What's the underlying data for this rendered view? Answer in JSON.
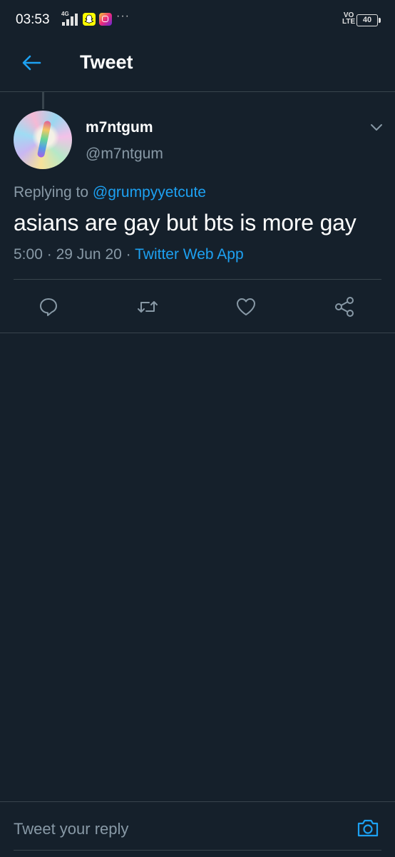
{
  "status_bar": {
    "time": "03:53",
    "network_label": "4G",
    "volte_line1": "VO",
    "volte_line2": "LTE",
    "battery": "40",
    "more": "···",
    "icons": [
      "signal-icon",
      "snapchat-icon",
      "instagram-icon",
      "more-icon",
      "volte-icon",
      "battery-icon"
    ]
  },
  "header": {
    "back_icon": "arrow-left-icon",
    "title": "Tweet"
  },
  "tweet": {
    "display_name": "m7ntgum",
    "handle": "@m7ntgum",
    "replying_prefix": "Replying to",
    "replying_to": "@grumpyyetcute",
    "text": "asians are gay but bts is more gay",
    "time": "5:00",
    "separator": "·",
    "date": "29 Jun 20",
    "source": "Twitter Web App",
    "menu_icon": "chevron-down-icon"
  },
  "actions": [
    {
      "name": "reply",
      "icon": "reply-icon"
    },
    {
      "name": "retweet",
      "icon": "retweet-icon"
    },
    {
      "name": "like",
      "icon": "heart-icon"
    },
    {
      "name": "share",
      "icon": "share-icon"
    }
  ],
  "composer": {
    "placeholder": "Tweet your reply",
    "camera_icon": "camera-icon"
  },
  "colors": {
    "background": "#15202b",
    "accent": "#1da1f2",
    "secondary_text": "#8899a6",
    "divider": "#38444d"
  }
}
